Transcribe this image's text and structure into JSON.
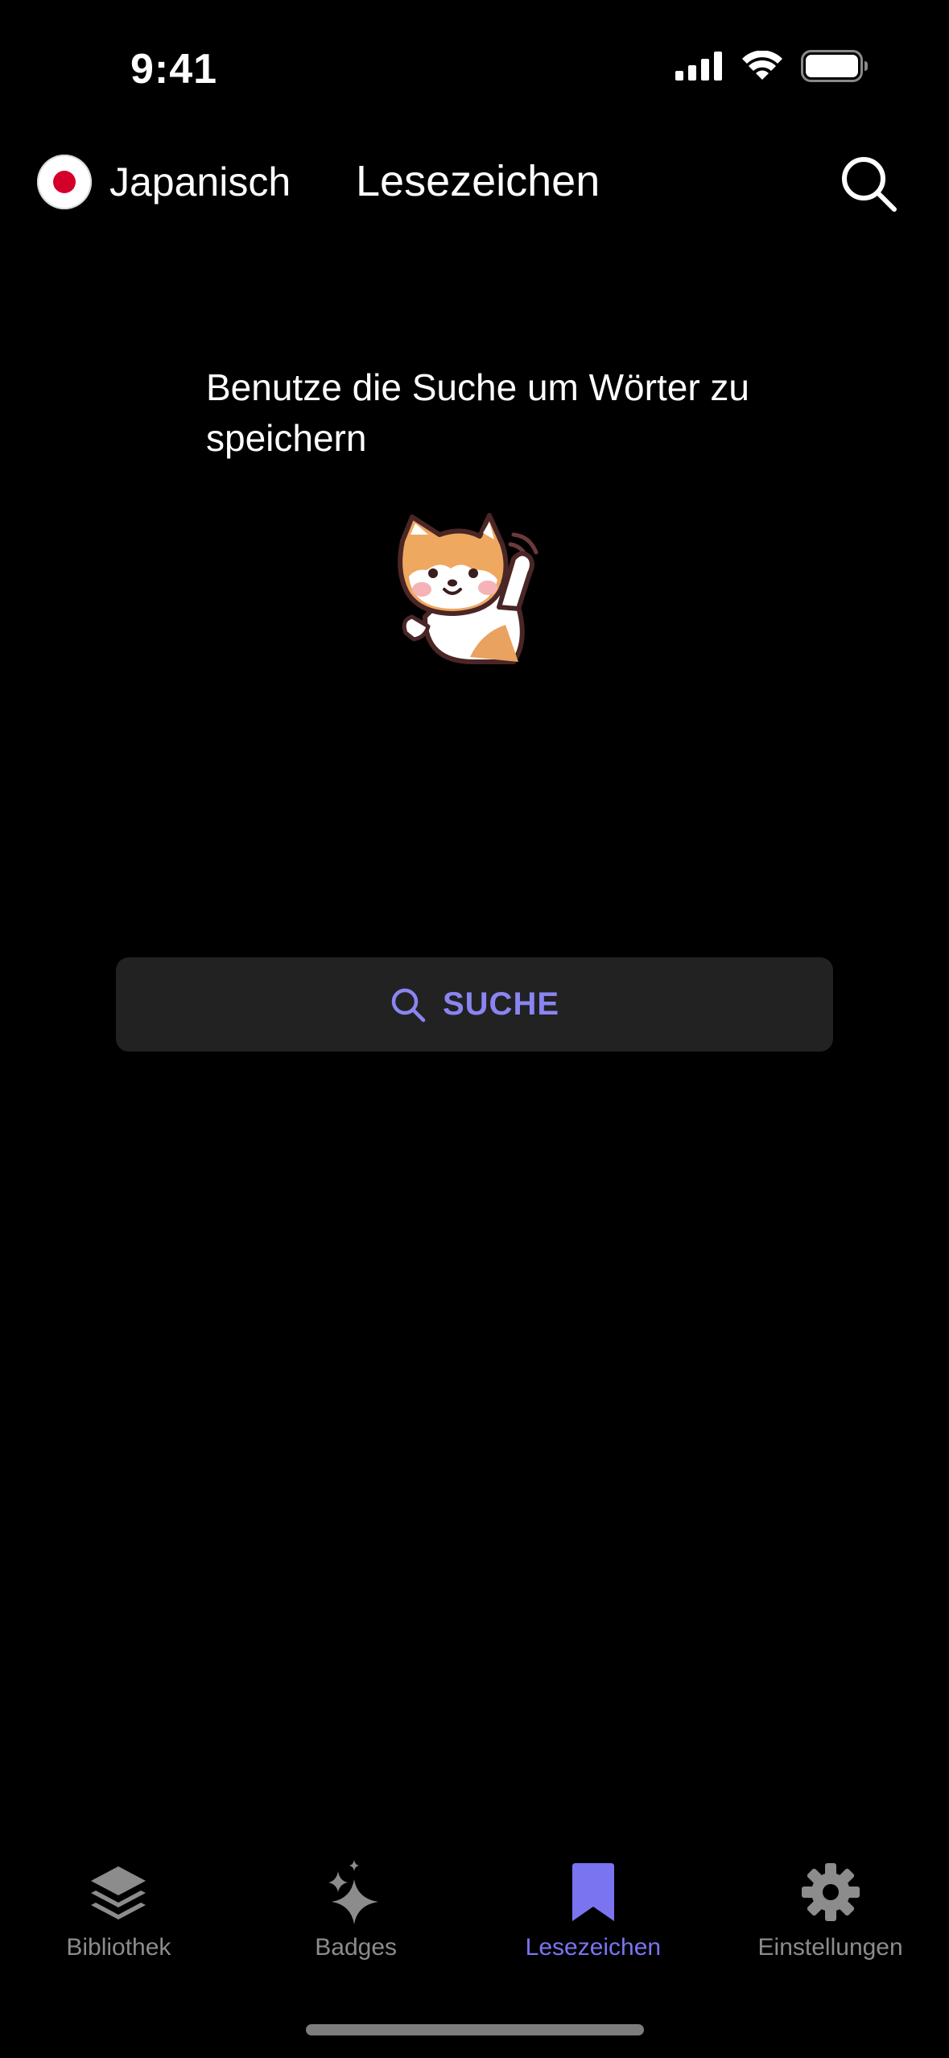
{
  "status_bar": {
    "time": "9:41"
  },
  "header": {
    "language": "Japanisch",
    "title": "Lesezeichen",
    "flag_color": "#d4002a",
    "search_icon": "search-icon"
  },
  "empty_state": {
    "message": "Benutze die Suche um Wörter zu speichern",
    "mascot": "shiba-inu-waving-illustration"
  },
  "search_button": {
    "label": "SUCHE",
    "accent_color": "#8a85f2"
  },
  "tabs": [
    {
      "label": "Bibliothek",
      "icon": "layers-icon",
      "active": false
    },
    {
      "label": "Badges",
      "icon": "sparkles-icon",
      "active": false
    },
    {
      "label": "Lesezeichen",
      "icon": "bookmark-icon",
      "active": true
    },
    {
      "label": "Einstellungen",
      "icon": "gear-icon",
      "active": false
    }
  ],
  "colors": {
    "background": "#000000",
    "active_tab": "#7b74f0",
    "inactive_tab": "#8c8c8c",
    "button_bg": "#222222"
  }
}
